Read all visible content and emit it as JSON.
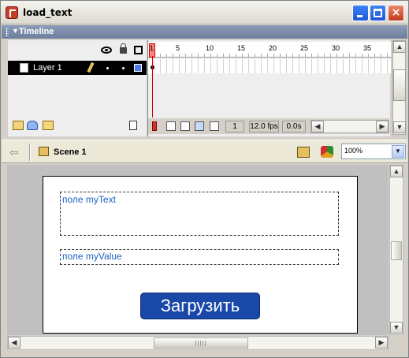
{
  "window": {
    "title": "load_text"
  },
  "timeline": {
    "title": "Timeline",
    "layer": {
      "name": "Layer 1",
      "color": "#4a7df0"
    },
    "ruler_marks": [
      "1",
      "5",
      "10",
      "15",
      "20",
      "25",
      "30",
      "35"
    ],
    "current_frame": "1",
    "fps": "12.0 fps",
    "elapsed": "0.0s"
  },
  "scene": {
    "label": "Scene 1",
    "zoom": "100%"
  },
  "stage": {
    "text_field_label": "поле myText",
    "value_field_label": "поле myValue",
    "load_button_label": "Загрузить"
  }
}
